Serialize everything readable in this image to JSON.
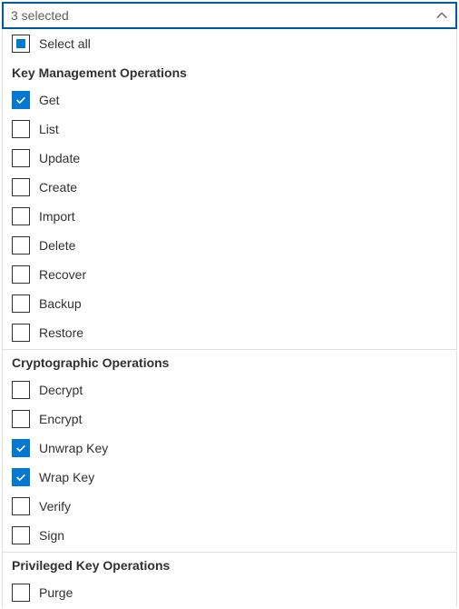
{
  "dropdown": {
    "summary": "3 selected",
    "selectAll": {
      "label": "Select all",
      "state": "indeterminate"
    }
  },
  "groups": [
    {
      "title": "Key Management Operations",
      "options": [
        {
          "label": "Get",
          "checked": true
        },
        {
          "label": "List",
          "checked": false
        },
        {
          "label": "Update",
          "checked": false
        },
        {
          "label": "Create",
          "checked": false
        },
        {
          "label": "Import",
          "checked": false
        },
        {
          "label": "Delete",
          "checked": false
        },
        {
          "label": "Recover",
          "checked": false
        },
        {
          "label": "Backup",
          "checked": false
        },
        {
          "label": "Restore",
          "checked": false
        }
      ]
    },
    {
      "title": "Cryptographic Operations",
      "options": [
        {
          "label": "Decrypt",
          "checked": false
        },
        {
          "label": "Encrypt",
          "checked": false
        },
        {
          "label": "Unwrap Key",
          "checked": true
        },
        {
          "label": "Wrap Key",
          "checked": true
        },
        {
          "label": "Verify",
          "checked": false
        },
        {
          "label": "Sign",
          "checked": false
        }
      ]
    },
    {
      "title": "Privileged Key Operations",
      "options": [
        {
          "label": "Purge",
          "checked": false
        }
      ]
    }
  ]
}
